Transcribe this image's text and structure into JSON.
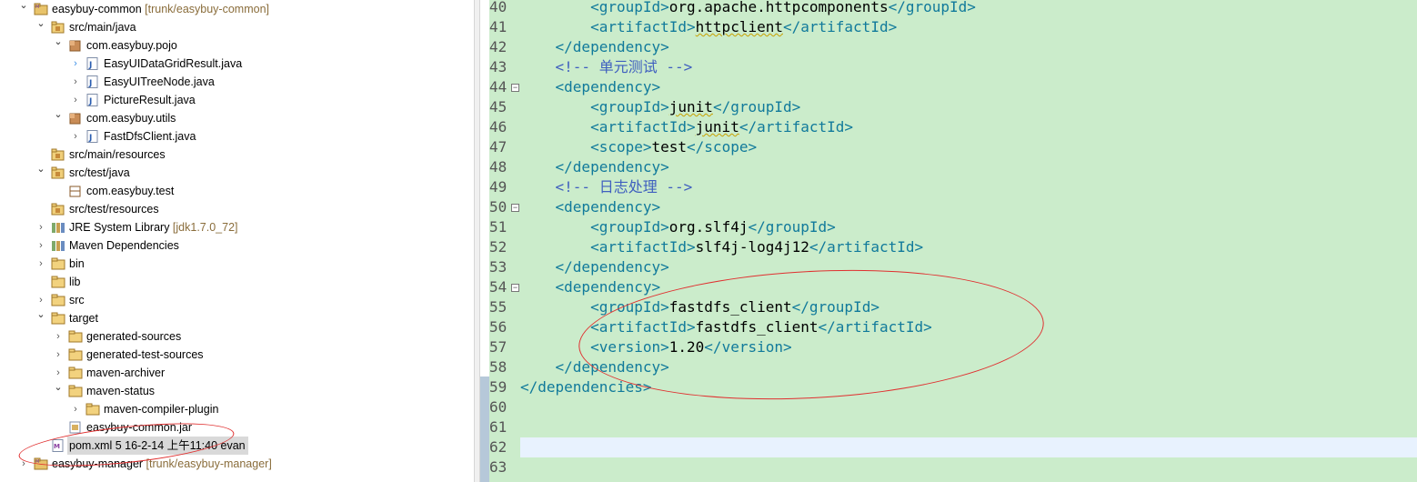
{
  "explorer": {
    "rows": [
      {
        "label": "easybuy-common",
        "decor": "[trunk/easybuy-common]",
        "indent": 0,
        "twisty": "open",
        "icon": "project-icon"
      },
      {
        "label": "src/main/java",
        "decor": "",
        "indent": 1,
        "twisty": "open",
        "icon": "source-folder-icon"
      },
      {
        "label": "com.easybuy.pojo",
        "decor": "",
        "indent": 2,
        "twisty": "open",
        "icon": "package-icon"
      },
      {
        "label": "EasyUIDataGridResult.java",
        "decor": "",
        "indent": 3,
        "twisty": "active",
        "icon": "java-file-icon"
      },
      {
        "label": "EasyUITreeNode.java",
        "decor": "",
        "indent": 3,
        "twisty": "closed",
        "icon": "java-file-icon"
      },
      {
        "label": "PictureResult.java",
        "decor": "",
        "indent": 3,
        "twisty": "closed",
        "icon": "java-file-icon"
      },
      {
        "label": "com.easybuy.utils",
        "decor": "",
        "indent": 2,
        "twisty": "open",
        "icon": "package-icon"
      },
      {
        "label": "FastDfsClient.java",
        "decor": "",
        "indent": 3,
        "twisty": "closed",
        "icon": "java-file-icon"
      },
      {
        "label": "src/main/resources",
        "decor": "",
        "indent": 1,
        "twisty": "none",
        "icon": "source-folder-icon"
      },
      {
        "label": "src/test/java",
        "decor": "",
        "indent": 1,
        "twisty": "open",
        "icon": "source-folder-icon"
      },
      {
        "label": "com.easybuy.test",
        "decor": "",
        "indent": 2,
        "twisty": "none",
        "icon": "empty-package-icon"
      },
      {
        "label": "src/test/resources",
        "decor": "",
        "indent": 1,
        "twisty": "none",
        "icon": "source-folder-icon"
      },
      {
        "label": "JRE System Library",
        "decor": "[jdk1.7.0_72]",
        "indent": 1,
        "twisty": "closed",
        "icon": "library-icon"
      },
      {
        "label": "Maven Dependencies",
        "decor": "",
        "indent": 1,
        "twisty": "closed",
        "icon": "library-icon"
      },
      {
        "label": "bin",
        "decor": "",
        "indent": 1,
        "twisty": "closed",
        "icon": "folder-icon"
      },
      {
        "label": "lib",
        "decor": "",
        "indent": 1,
        "twisty": "none",
        "icon": "folder-icon"
      },
      {
        "label": "src",
        "decor": "",
        "indent": 1,
        "twisty": "closed",
        "icon": "folder-icon"
      },
      {
        "label": "target",
        "decor": "",
        "indent": 1,
        "twisty": "open",
        "icon": "folder-icon"
      },
      {
        "label": "generated-sources",
        "decor": "",
        "indent": 2,
        "twisty": "closed",
        "icon": "folder-icon"
      },
      {
        "label": "generated-test-sources",
        "decor": "",
        "indent": 2,
        "twisty": "closed",
        "icon": "folder-icon"
      },
      {
        "label": "maven-archiver",
        "decor": "",
        "indent": 2,
        "twisty": "closed",
        "icon": "folder-icon"
      },
      {
        "label": "maven-status",
        "decor": "",
        "indent": 2,
        "twisty": "open",
        "icon": "folder-icon"
      },
      {
        "label": "maven-compiler-plugin",
        "decor": "",
        "indent": 3,
        "twisty": "closed",
        "icon": "folder-icon"
      },
      {
        "label": "easybuy-common.jar",
        "decor": "",
        "indent": 2,
        "twisty": "none",
        "icon": "jar-icon"
      },
      {
        "label": "pom.xml 5  16-2-14 上午11:40  evan",
        "decor": "",
        "indent": 1,
        "twisty": "none",
        "icon": "xml-file-icon",
        "selected": true
      },
      {
        "label": "easybuy-manager",
        "decor": "[trunk/easybuy-manager]",
        "indent": 0,
        "twisty": "closed",
        "icon": "project-icon"
      }
    ]
  },
  "editor": {
    "lines": [
      {
        "n": "40",
        "parts": [
          [
            "t",
            "        <groupId>"
          ],
          [
            "v",
            "org.apache.httpcomponents"
          ],
          [
            "t",
            "</groupId>"
          ]
        ]
      },
      {
        "n": "41",
        "parts": [
          [
            "t",
            "        <artifactId>"
          ],
          [
            "v",
            "httpclient",
            "sq"
          ],
          [
            "t",
            "</artifactId>"
          ]
        ]
      },
      {
        "n": "42",
        "parts": [
          [
            "t",
            "    </dependency>"
          ]
        ]
      },
      {
        "n": "43",
        "parts": [
          [
            "c",
            "    <!-- 单元测试 -->"
          ]
        ]
      },
      {
        "n": "44",
        "parts": [
          [
            "t",
            "    <dependency>"
          ]
        ],
        "fold": true
      },
      {
        "n": "45",
        "parts": [
          [
            "t",
            "        <groupId>"
          ],
          [
            "v",
            "junit",
            "sq"
          ],
          [
            "t",
            "</groupId>"
          ]
        ]
      },
      {
        "n": "46",
        "parts": [
          [
            "t",
            "        <artifactId>"
          ],
          [
            "v",
            "junit",
            "sq"
          ],
          [
            "t",
            "</artifactId>"
          ]
        ]
      },
      {
        "n": "47",
        "parts": [
          [
            "t",
            "        <scope>"
          ],
          [
            "v",
            "test"
          ],
          [
            "t",
            "</scope>"
          ]
        ]
      },
      {
        "n": "48",
        "parts": [
          [
            "t",
            "    </dependency>"
          ]
        ]
      },
      {
        "n": "49",
        "parts": [
          [
            "c",
            "    <!-- 日志处理 -->"
          ]
        ]
      },
      {
        "n": "50",
        "parts": [
          [
            "t",
            "    <dependency>"
          ]
        ],
        "fold": true
      },
      {
        "n": "51",
        "parts": [
          [
            "t",
            "        <groupId>"
          ],
          [
            "v",
            "org.slf4j"
          ],
          [
            "t",
            "</groupId>"
          ]
        ]
      },
      {
        "n": "52",
        "parts": [
          [
            "t",
            "        <artifactId>"
          ],
          [
            "v",
            "slf4j-log4j12"
          ],
          [
            "t",
            "</artifactId>"
          ]
        ]
      },
      {
        "n": "53",
        "parts": [
          [
            "t",
            "    </dependency>"
          ]
        ]
      },
      {
        "n": "54",
        "parts": [
          [
            "t",
            "    <dependency>"
          ]
        ],
        "fold": true
      },
      {
        "n": "55",
        "parts": [
          [
            "t",
            "        <groupId>"
          ],
          [
            "v",
            "fastdfs_client"
          ],
          [
            "t",
            "</groupId>"
          ]
        ]
      },
      {
        "n": "56",
        "parts": [
          [
            "t",
            "        <artifactId>"
          ],
          [
            "v",
            "fastdfs_client"
          ],
          [
            "t",
            "</artifactId>"
          ]
        ]
      },
      {
        "n": "57",
        "parts": [
          [
            "t",
            "        <version>"
          ],
          [
            "v",
            "1.20"
          ],
          [
            "t",
            "</version>"
          ]
        ]
      },
      {
        "n": "58",
        "parts": [
          [
            "t",
            "    </dependency>"
          ]
        ]
      },
      {
        "n": "59",
        "parts": [
          [
            "t",
            "</dependencies>"
          ]
        ]
      },
      {
        "n": "60",
        "parts": []
      },
      {
        "n": "61",
        "parts": []
      },
      {
        "n": "62",
        "parts": []
      },
      {
        "n": "63",
        "parts": []
      }
    ]
  }
}
